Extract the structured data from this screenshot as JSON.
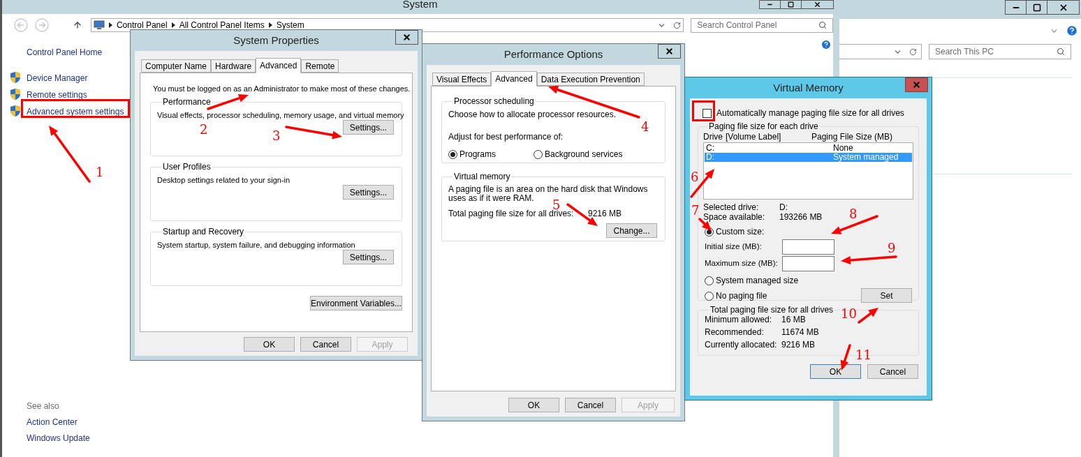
{
  "system_window": {
    "title": "System",
    "breadcrumb": [
      "Control Panel",
      "All Control Panel Items",
      "System"
    ],
    "search": {
      "placeholder": "Search Control Panel"
    },
    "nav_home": "Control Panel Home",
    "nav_links": [
      {
        "label": "Device Manager",
        "highlighted": false
      },
      {
        "label": "Remote settings",
        "highlighted": false
      },
      {
        "label": "Advanced system settings",
        "highlighted": true
      }
    ],
    "see_also": {
      "heading": "See also",
      "links": [
        "Action Center",
        "Windows Update"
      ]
    }
  },
  "explorer_window": {
    "search": {
      "placeholder": "Search This PC"
    }
  },
  "system_properties": {
    "title": "System Properties",
    "tabs": [
      {
        "label": "Computer Name",
        "selected": false
      },
      {
        "label": "Hardware",
        "selected": false
      },
      {
        "label": "Advanced",
        "selected": true
      },
      {
        "label": "Remote",
        "selected": false
      }
    ],
    "notice": "You must be logged on as an Administrator to make most of these changes.",
    "groups": [
      {
        "title": "Performance",
        "description": "Visual effects, processor scheduling, memory usage, and virtual memory",
        "button": "Settings..."
      },
      {
        "title": "User Profiles",
        "description": "Desktop settings related to your sign-in",
        "button": "Settings..."
      },
      {
        "title": "Startup and Recovery",
        "description": "System startup, system failure, and debugging information",
        "button": "Settings..."
      }
    ],
    "env_button": "Environment Variables...",
    "buttons": [
      {
        "label": "OK",
        "disabled": false
      },
      {
        "label": "Cancel",
        "disabled": false
      },
      {
        "label": "Apply",
        "disabled": true
      }
    ]
  },
  "performance_options": {
    "title": "Performance Options",
    "tabs": [
      {
        "label": "Visual Effects",
        "selected": false
      },
      {
        "label": "Advanced",
        "selected": true
      },
      {
        "label": "Data Execution Prevention",
        "selected": false
      }
    ],
    "processor_scheduling": {
      "title": "Processor scheduling",
      "description": "Choose how to allocate processor resources.",
      "prompt": "Adjust for best performance of:",
      "options": [
        {
          "label": "Programs",
          "selected": true
        },
        {
          "label": "Background services",
          "selected": false
        }
      ]
    },
    "virtual_memory": {
      "title": "Virtual memory",
      "description": "A paging file is an area on the hard disk that Windows uses as if it were RAM.",
      "total_label": "Total paging file size for all drives:",
      "total_value": "9216 MB",
      "button": "Change..."
    },
    "buttons": [
      {
        "label": "OK",
        "disabled": false
      },
      {
        "label": "Cancel",
        "disabled": false
      },
      {
        "label": "Apply",
        "disabled": true
      }
    ]
  },
  "virtual_memory": {
    "title": "Virtual Memory",
    "auto_manage": {
      "label": "Automatically manage paging file size for all drives",
      "checked": false,
      "highlighted": true
    },
    "drive_group": {
      "title": "Paging file size for each drive",
      "columns": [
        "Drive",
        "[Volume Label]",
        "Paging File Size (MB)"
      ],
      "drives": [
        {
          "drive": "C:",
          "size": "None",
          "selected": false
        },
        {
          "drive": "D:",
          "size": "System managed",
          "selected": true
        }
      ],
      "info": [
        {
          "label": "Selected drive:",
          "value": "D:"
        },
        {
          "label": "Space available:",
          "value": "193266 MB"
        }
      ],
      "options": [
        {
          "label": "Custom size:",
          "selected": true
        },
        {
          "label": "System managed size",
          "selected": false
        },
        {
          "label": "No paging file",
          "selected": false
        }
      ],
      "fields": [
        {
          "label": "Initial size (MB):"
        },
        {
          "label": "Maximum size (MB):"
        }
      ],
      "set_button": "Set"
    },
    "totals": {
      "title": "Total paging file size for all drives",
      "rows": [
        {
          "label": "Minimum allowed:",
          "value": "16 MB"
        },
        {
          "label": "Recommended:",
          "value": "11674 MB"
        },
        {
          "label": "Currently allocated:",
          "value": "9216 MB"
        }
      ]
    },
    "buttons": [
      {
        "label": "OK",
        "focused": true
      },
      {
        "label": "Cancel",
        "focused": false
      }
    ]
  },
  "annotations": [
    {
      "label": "1"
    },
    {
      "label": "2"
    },
    {
      "label": "3"
    },
    {
      "label": "4"
    },
    {
      "label": "5"
    },
    {
      "label": "6"
    },
    {
      "label": "7"
    },
    {
      "label": "8"
    },
    {
      "label": "9"
    },
    {
      "label": "10"
    },
    {
      "label": "11"
    }
  ]
}
